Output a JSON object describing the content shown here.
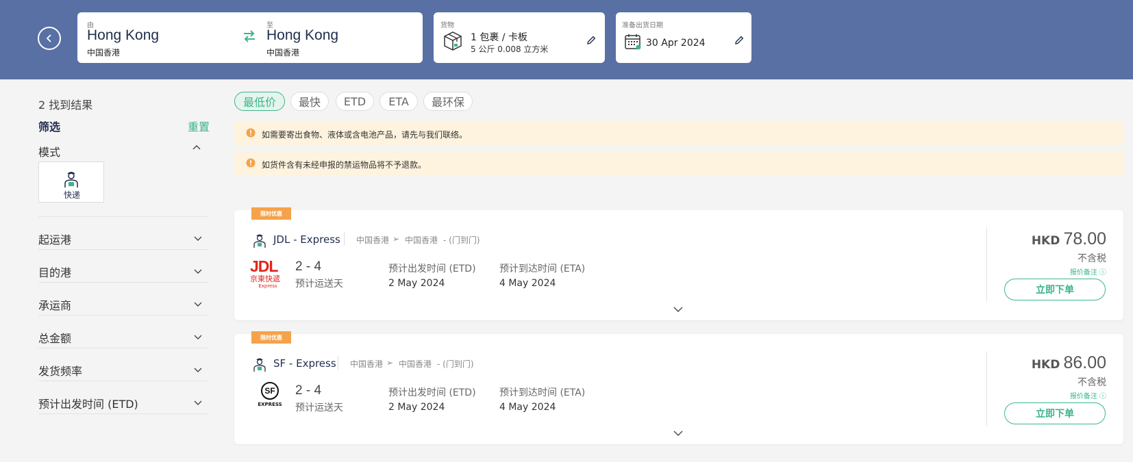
{
  "header": {
    "from_label": "由",
    "from_city": "Hong Kong",
    "from_region": "中国香港",
    "to_label": "至",
    "to_city": "Hong Kong",
    "to_region": "中国香港",
    "cargo_label": "货物",
    "cargo_main": "1 包裹 / 卡板",
    "cargo_sub": "5 公斤 0.008 立方米",
    "date_label": "准备出货日期",
    "date_value": "30 Apr 2024"
  },
  "sidebar": {
    "results_count": "2 找到结果",
    "filter_title": "筛选",
    "reset_label": "重置",
    "mode_title": "模式",
    "mode_tile_label": "快递",
    "filters": [
      "起运港",
      "目的港",
      "承运商",
      "总金额",
      "发货频率",
      "预计出发时间 (ETD)"
    ]
  },
  "sort_tabs": [
    {
      "label": "最低价",
      "active": true
    },
    {
      "label": "最快",
      "active": false
    },
    {
      "label": "ETD",
      "active": false
    },
    {
      "label": "ETA",
      "active": false
    },
    {
      "label": "最环保",
      "active": false
    }
  ],
  "notices": [
    "如需要寄出食物、液体或含电池产品，请先与我们联络。",
    "如货件含有未经申报的禁运物品将不予退款。"
  ],
  "results": [
    {
      "badge": "限时优惠",
      "carrier": "JDL - Express",
      "origin": "中国香港",
      "destination": "中国香港",
      "service": "- (门到门)",
      "logo_text": "JDL",
      "logo_sub": "京東快遞",
      "logo_tag": "Express",
      "days": "2 - 4",
      "days_label": "预计运送天",
      "etd_label": "预计出发时间 (ETD)",
      "etd": "2 May 2024",
      "eta_label": "预计到达时间 (ETA)",
      "eta": "4 May 2024",
      "currency": "HKD",
      "amount": "78.00",
      "tax_note": "不含税",
      "quote_note": "报价备注 ⓘ",
      "order_label": "立即下单"
    },
    {
      "badge": "限时优惠",
      "carrier": "SF - Express",
      "origin": "中国香港",
      "destination": "中国香港",
      "service": "- (门到门)",
      "logo_text": "SF",
      "logo_sub": "EXPRESS",
      "logo_tag": "",
      "days": "2 - 4",
      "days_label": "预计运送天",
      "etd_label": "预计出发时间 (ETD)",
      "etd": "2 May 2024",
      "eta_label": "预计到达时间 (ETA)",
      "eta": "4 May 2024",
      "currency": "HKD",
      "amount": "86.00",
      "tax_note": "不含税",
      "quote_note": "报价备注 ⓘ",
      "order_label": "立即下单"
    }
  ],
  "colors": {
    "header_bg": "#5870a4",
    "accent_green": "#3cb48c",
    "promo_orange": "#f5a24a",
    "notice_bg": "#fdf3de",
    "jdl_red": "#e1251b"
  },
  "icons": [
    "back-arrow-icon",
    "swap-icon",
    "package-box-icon",
    "pencil-edit-icon",
    "calendar-icon",
    "courier-icon",
    "chevron-up-icon",
    "chevron-down-icon",
    "info-icon"
  ]
}
